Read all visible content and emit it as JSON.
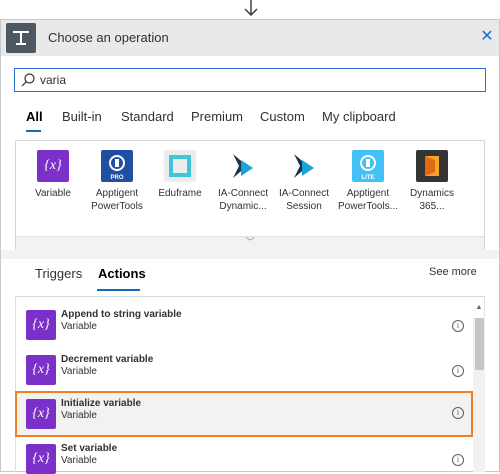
{
  "header": {
    "title": "Choose an operation"
  },
  "search": {
    "value": "varia"
  },
  "filter_tabs": [
    {
      "label": "All"
    },
    {
      "label": "Built-in"
    },
    {
      "label": "Standard"
    },
    {
      "label": "Premium"
    },
    {
      "label": "Custom"
    },
    {
      "label": "My clipboard"
    }
  ],
  "connectors": [
    {
      "label": "Variable",
      "icon": "variable-icon",
      "color": "#7a30c9"
    },
    {
      "label": "Apptigent PowerTools",
      "label_l1": "Apptigent",
      "label_l2": "PowerTools",
      "icon": "apptigent-pro-icon",
      "color": "#1f4fa3",
      "badge": "PRO"
    },
    {
      "label": "Eduframe",
      "icon": "eduframe-icon",
      "color": "#ececec"
    },
    {
      "label_l1": "IA-Connect",
      "label_l2": "Dynamic...",
      "icon": "ia-connect-dynamic-icon",
      "color": "#ffffff"
    },
    {
      "label_l1": "IA-Connect",
      "label_l2": "Session",
      "icon": "ia-connect-session-icon",
      "color": "#ffffff"
    },
    {
      "label_l1": "Apptigent",
      "label_l2": "PowerTools...",
      "icon": "apptigent-lite-icon",
      "color": "#43c0f5",
      "badge": "LITE"
    },
    {
      "label_l1": "Dynamics",
      "label_l2": "365...",
      "icon": "dynamics-365-icon",
      "color": "#333333"
    }
  ],
  "action_tabs": [
    {
      "label": "Triggers"
    },
    {
      "label": "Actions"
    }
  ],
  "see_more": "See more",
  "actions": [
    {
      "title": "Append to string variable",
      "subtitle": "Variable",
      "icon_text": "{x}"
    },
    {
      "title": "Decrement variable",
      "subtitle": "Variable",
      "icon_text": "{x}"
    },
    {
      "title": "Initialize variable",
      "subtitle": "Variable",
      "icon_text": "{x}",
      "selected": true
    },
    {
      "title": "Set variable",
      "subtitle": "Variable",
      "icon_text": "{x}"
    }
  ],
  "colors": {
    "accent": "#0f6cbd",
    "selection": "#f07f24",
    "variable": "#7a30c9"
  }
}
